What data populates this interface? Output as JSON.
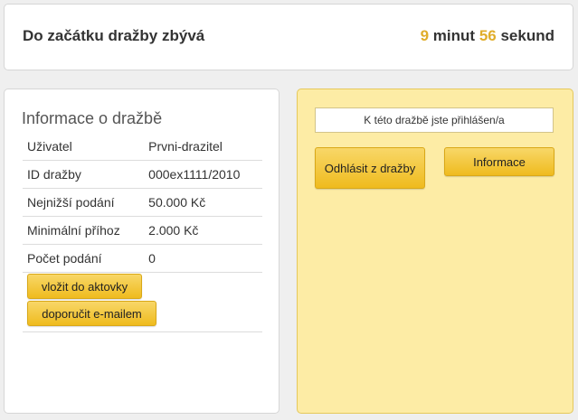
{
  "countdown": {
    "label": "Do začátku dražby zbývá",
    "minutes": "9",
    "minutes_unit": "minut",
    "seconds": "56",
    "seconds_unit": "sekund"
  },
  "info": {
    "title": "Informace o dražbě",
    "rows": [
      {
        "label": "Uživatel",
        "value": "Prvni-drazitel"
      },
      {
        "label": "ID dražby",
        "value": "000ex1111/2010"
      },
      {
        "label": "Nejnižší podání",
        "value": "50.000 Kč"
      },
      {
        "label": "Minimální příhoz",
        "value": "2.000 Kč"
      },
      {
        "label": "Počet podání",
        "value": "0"
      }
    ],
    "briefcase_button": "vložit do aktovky",
    "recommend_button": "doporučit e-mailem"
  },
  "status": {
    "message": "K této dražbě jste přihlášen/a",
    "logout_button": "Odhlásit z dražby",
    "info_button": "Informace"
  },
  "colors": {
    "accent": "#e0ad2a",
    "button_top": "#f8d768",
    "button_bottom": "#efbb1e",
    "status_panel_bg": "#fdeca5"
  }
}
